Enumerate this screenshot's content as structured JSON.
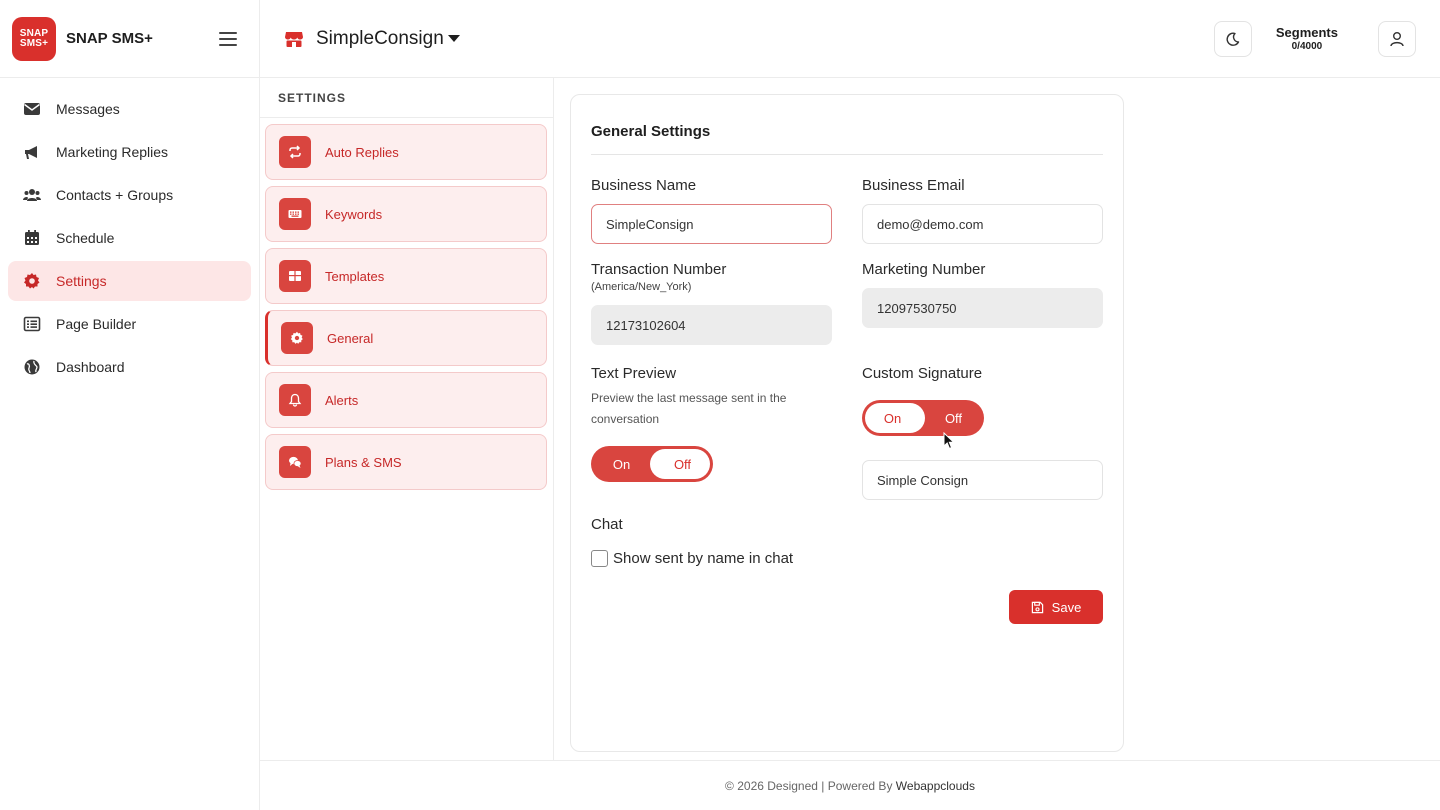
{
  "brand": {
    "logo_line1": "SNAP",
    "logo_line2": "SMS+",
    "name": "SNAP SMS+"
  },
  "sidebar": {
    "items": [
      {
        "label": "Messages",
        "icon": "envelope-icon"
      },
      {
        "label": "Marketing Replies",
        "icon": "megaphone-icon"
      },
      {
        "label": "Contacts + Groups",
        "icon": "users-icon"
      },
      {
        "label": "Schedule",
        "icon": "calendar-icon"
      },
      {
        "label": "Settings",
        "icon": "gear-icon",
        "active": true
      },
      {
        "label": "Page Builder",
        "icon": "list-icon"
      },
      {
        "label": "Dashboard",
        "icon": "globe-icon"
      }
    ]
  },
  "header": {
    "store_name": "SimpleConsign",
    "segments_label": "Segments",
    "segments_count": "0/4000"
  },
  "settings_menu": {
    "heading": "SETTINGS",
    "items": [
      {
        "label": "Auto Replies",
        "icon": "repeat-icon"
      },
      {
        "label": "Keywords",
        "icon": "keyboard-icon"
      },
      {
        "label": "Templates",
        "icon": "table-icon"
      },
      {
        "label": "General",
        "icon": "gear-icon",
        "active": true
      },
      {
        "label": "Alerts",
        "icon": "bell-icon"
      },
      {
        "label": "Plans & SMS",
        "icon": "chat-bubbles-icon"
      }
    ]
  },
  "general": {
    "title": "General Settings",
    "business_name_label": "Business Name",
    "business_name_value": "SimpleConsign",
    "business_email_label": "Business Email",
    "business_email_value": "demo@demo.com",
    "transaction_number_label": "Transaction Number",
    "transaction_number_tz": "(America/New_York)",
    "transaction_number_value": "12173102604",
    "marketing_number_label": "Marketing Number",
    "marketing_number_value": "12097530750",
    "text_preview_label": "Text Preview",
    "text_preview_help": "Preview the last message sent in the conversation",
    "text_preview_on": "On",
    "text_preview_off": "Off",
    "text_preview_state": "off",
    "custom_signature_label": "Custom Signature",
    "custom_signature_on": "On",
    "custom_signature_off": "Off",
    "custom_signature_state": "on",
    "signature_value": "Simple Consign",
    "chat_label": "Chat",
    "show_sent_by_label": "Show sent by name in chat",
    "show_sent_by_checked": false,
    "save_label": "Save"
  },
  "footer": {
    "text": "© 2026 Designed | Powered By ",
    "link": "Webappclouds"
  },
  "colors": {
    "accent": "#d9302c",
    "accent_light": "#fdeeee",
    "active_nav_bg": "#fde6e6"
  }
}
